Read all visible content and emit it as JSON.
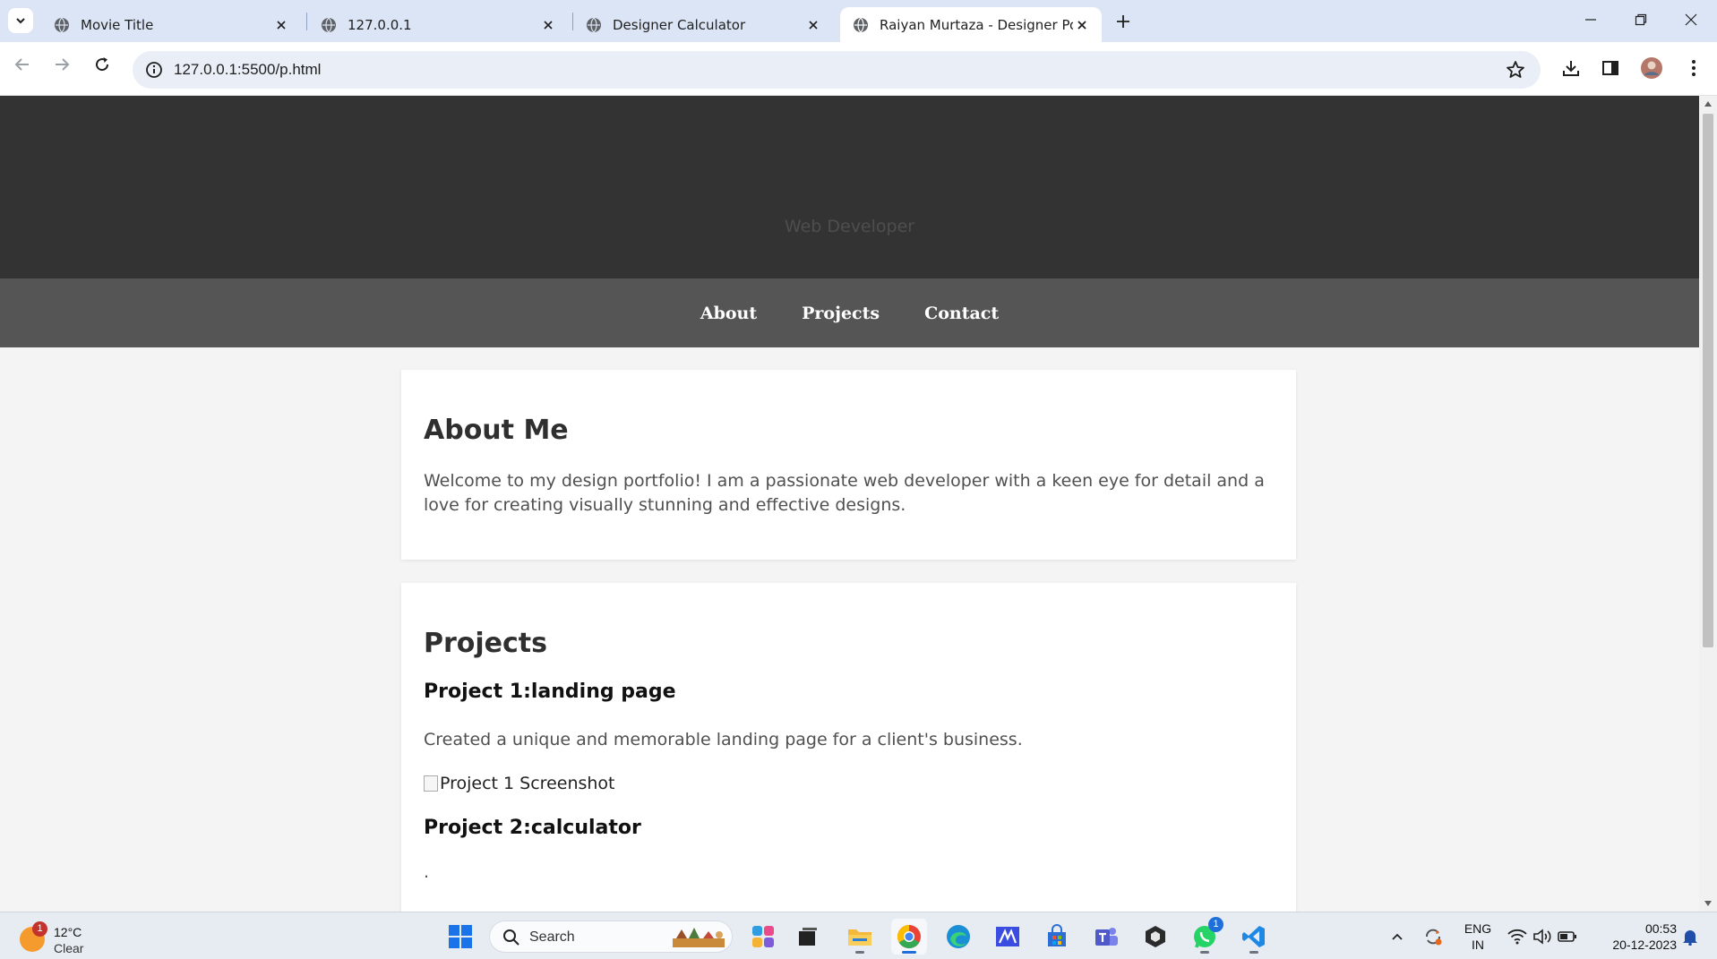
{
  "browser": {
    "tabs": [
      {
        "title": "Movie Title",
        "active": false
      },
      {
        "title": "127.0.0.1",
        "active": false
      },
      {
        "title": "Designer Calculator",
        "active": false
      },
      {
        "title": "Raiyan Murtaza - Designer Portfolio",
        "active": true
      }
    ],
    "url": "127.0.0.1:5500/p.html"
  },
  "page": {
    "header": {
      "subtitle": "Web Developer"
    },
    "nav": [
      "About",
      "Projects",
      "Contact"
    ],
    "about": {
      "heading": "About Me",
      "text": "Welcome to my design portfolio! I am a passionate web developer with a keen eye for detail and a love for creating visually stunning and effective designs."
    },
    "projects": {
      "heading": "Projects",
      "items": [
        {
          "title": "Project 1:landing page",
          "description": "Created a unique and memorable landing page for a client's business.",
          "image_alt": "Project 1 Screenshot"
        },
        {
          "title": "Project 2:calculator",
          "description": "."
        }
      ]
    }
  },
  "taskbar": {
    "weather": {
      "temp": "12°C",
      "condition": "Clear",
      "badge": "1"
    },
    "search_label": "Search",
    "whatsapp_badge": "1",
    "language": {
      "line1": "ENG",
      "line2": "IN"
    },
    "clock": {
      "time": "00:53",
      "date": "20-12-2023"
    }
  },
  "colors": {
    "header_bg": "#333333",
    "nav_bg": "#555555",
    "tabstrip_bg": "#dce5f5",
    "page_bg": "#f4f4f4"
  }
}
